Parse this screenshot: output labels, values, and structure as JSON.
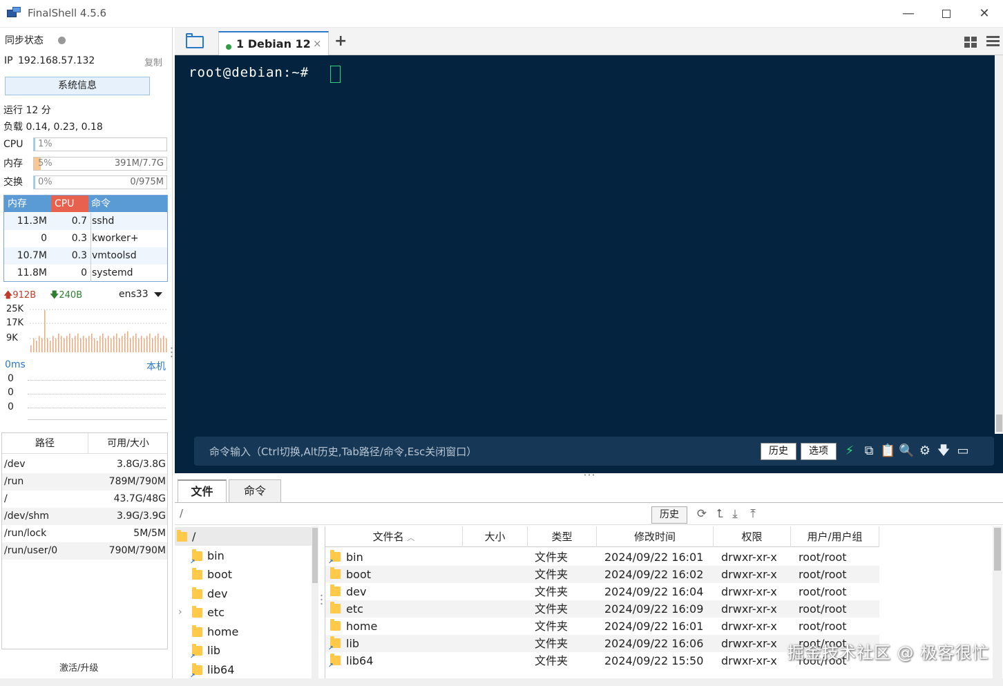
{
  "window": {
    "title": "FinalShell 4.5.6"
  },
  "sidebar": {
    "sync_label": "同步状态",
    "ip_label": "IP",
    "ip": "192.168.57.132",
    "copy": "复制",
    "sysinfo_button": "系统信息",
    "uptime": "运行 12 分",
    "load": "负载 0.14, 0.23, 0.18",
    "meters": [
      {
        "label": "CPU",
        "percent": "1%",
        "extra": "",
        "fill": 0.01,
        "color": "#8fd0f4"
      },
      {
        "label": "内存",
        "percent": "5%",
        "extra": "391M/7.7G",
        "fill": 0.05,
        "color": "#f7c893"
      },
      {
        "label": "交换",
        "percent": "0%",
        "extra": "0/975M",
        "fill": 0.0,
        "color": "#8fd0f4"
      }
    ],
    "process_table": {
      "headers": {
        "mem": "内存",
        "cpu": "CPU",
        "cmd": "命令"
      },
      "rows": [
        {
          "mem": "11.3M",
          "cpu": "0.7",
          "cmd": "sshd"
        },
        {
          "mem": "0",
          "cpu": "0.3",
          "cmd": "kworker+"
        },
        {
          "mem": "10.7M",
          "cpu": "0.3",
          "cmd": "vmtoolsd"
        },
        {
          "mem": "11.8M",
          "cpu": "0",
          "cmd": "systemd"
        }
      ]
    },
    "network": {
      "up": "912B",
      "down": "240B",
      "interface": "ens33",
      "y_labels": [
        "25K",
        "17K",
        "9K"
      ],
      "bars": [
        0.15,
        0.3,
        0.25,
        0.35,
        0.3,
        0.9,
        0.3,
        0.25,
        0.35,
        0.3,
        0.4,
        0.35,
        0.3,
        0.35,
        0.4,
        0.3,
        0.35,
        0.4,
        0.3,
        0.35,
        0.3,
        0.35,
        0.4,
        0.3,
        0.25,
        0.35,
        0.4,
        0.3,
        0.35,
        0.3,
        0.35,
        0.4,
        0.3,
        0.35,
        0.4,
        0.45,
        0.3,
        0.35,
        0.4,
        0.3,
        0.35,
        0.3,
        0.35,
        0.4,
        0.3,
        0.35,
        0.4,
        0.3,
        0.35,
        0.3
      ]
    },
    "ping": {
      "latency": "0ms",
      "host": "本机",
      "values": [
        "0",
        "0",
        "0"
      ]
    },
    "disks": {
      "headers": {
        "path": "路径",
        "size": "可用/大小"
      },
      "rows": [
        {
          "path": "/dev",
          "size": "3.8G/3.8G"
        },
        {
          "path": "/run",
          "size": "789M/790M"
        },
        {
          "path": "/",
          "size": "43.7G/48G"
        },
        {
          "path": "/dev/shm",
          "size": "3.9G/3.9G"
        },
        {
          "path": "/run/lock",
          "size": "5M/5M"
        },
        {
          "path": "/run/user/0",
          "size": "790M/790M"
        }
      ]
    },
    "activate": "激活/升级"
  },
  "tabs": {
    "session": "1  Debian 12",
    "close": "×",
    "add": "+"
  },
  "terminal": {
    "prompt": "root@debian:~#",
    "command_hint": "命令输入（Ctrl切换,Alt历史,Tab路径/命令,Esc关闭窗口）",
    "history_button": "历史",
    "options_button": "选项"
  },
  "files": {
    "tabs": {
      "files": "文件",
      "commands": "命令"
    },
    "path": "/",
    "history_button": "历史",
    "tree": [
      {
        "label": "/",
        "level": 0,
        "selected": true,
        "link": false,
        "expandable": false
      },
      {
        "label": "bin",
        "level": 1,
        "selected": false,
        "link": true,
        "expandable": false
      },
      {
        "label": "boot",
        "level": 1,
        "selected": false,
        "link": false,
        "expandable": false
      },
      {
        "label": "dev",
        "level": 1,
        "selected": false,
        "link": false,
        "expandable": false
      },
      {
        "label": "etc",
        "level": 1,
        "selected": false,
        "link": false,
        "expandable": true
      },
      {
        "label": "home",
        "level": 1,
        "selected": false,
        "link": false,
        "expandable": false
      },
      {
        "label": "lib",
        "level": 1,
        "selected": false,
        "link": true,
        "expandable": false
      },
      {
        "label": "lib64",
        "level": 1,
        "selected": false,
        "link": true,
        "expandable": false
      }
    ],
    "columns": {
      "name": "文件名",
      "size": "大小",
      "type": "类型",
      "mtime": "修改时间",
      "perm": "权限",
      "owner": "用户/用户组"
    },
    "rows": [
      {
        "name": "bin",
        "size": "",
        "type": "文件夹",
        "mtime": "2024/09/22 16:01",
        "perm": "drwxr-xr-x",
        "owner": "root/root",
        "link": true
      },
      {
        "name": "boot",
        "size": "",
        "type": "文件夹",
        "mtime": "2024/09/22 16:02",
        "perm": "drwxr-xr-x",
        "owner": "root/root",
        "link": false
      },
      {
        "name": "dev",
        "size": "",
        "type": "文件夹",
        "mtime": "2024/09/22 16:04",
        "perm": "drwxr-xr-x",
        "owner": "root/root",
        "link": false
      },
      {
        "name": "etc",
        "size": "",
        "type": "文件夹",
        "mtime": "2024/09/22 16:09",
        "perm": "drwxr-xr-x",
        "owner": "root/root",
        "link": false
      },
      {
        "name": "home",
        "size": "",
        "type": "文件夹",
        "mtime": "2024/09/22 16:01",
        "perm": "drwxr-xr-x",
        "owner": "root/root",
        "link": false
      },
      {
        "name": "lib",
        "size": "",
        "type": "文件夹",
        "mtime": "2024/09/22 16:06",
        "perm": "drwxr-xr-x",
        "owner": "root/root",
        "link": true
      },
      {
        "name": "lib64",
        "size": "",
        "type": "文件夹",
        "mtime": "2024/09/22 15:50",
        "perm": "drwxr-xr-x",
        "owner": "root/root",
        "link": true
      }
    ]
  },
  "watermark": "掘金技术社区 @ 极客很忙"
}
